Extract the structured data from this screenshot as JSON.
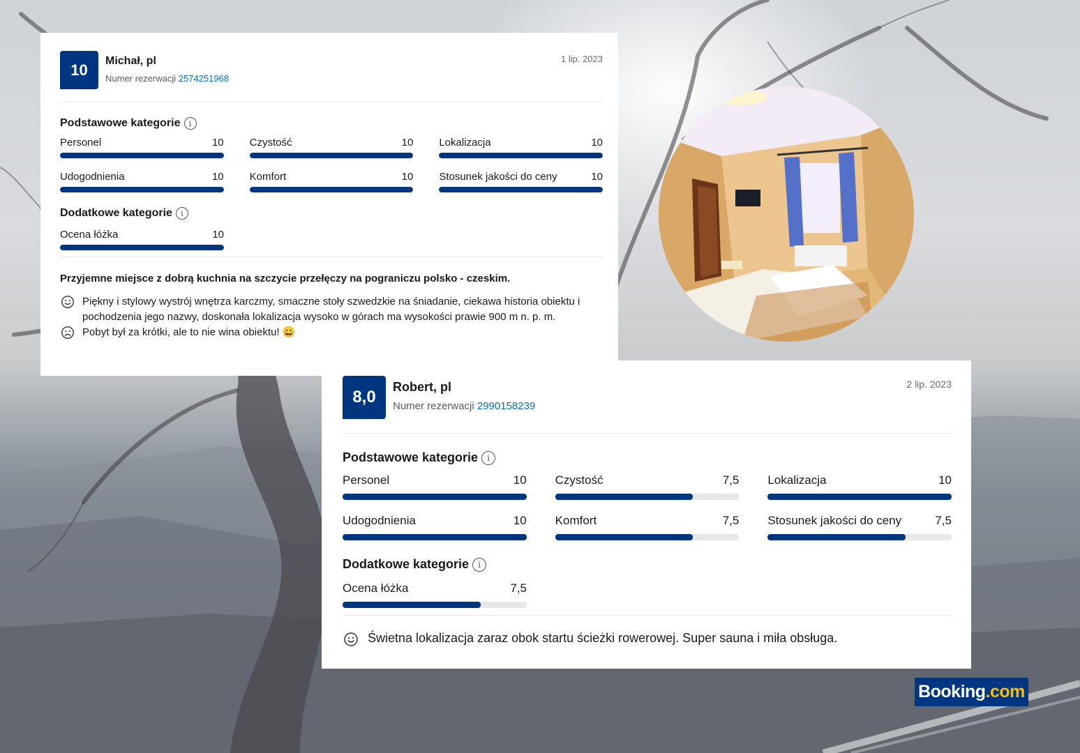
{
  "reviews": [
    {
      "score": "10",
      "name": "Michał, pl",
      "booking_label": "Numer rezerwacji",
      "booking_number": "2574251968",
      "date": "1 lip. 2023",
      "basic_title": "Podstawowe kategorie",
      "basic": [
        {
          "label": "Personel",
          "value": "10",
          "fraction": 1.0
        },
        {
          "label": "Czystość",
          "value": "10",
          "fraction": 1.0
        },
        {
          "label": "Lokalizacja",
          "value": "10",
          "fraction": 1.0
        },
        {
          "label": "Udogodnienia",
          "value": "10",
          "fraction": 1.0
        },
        {
          "label": "Komfort",
          "value": "10",
          "fraction": 1.0
        },
        {
          "label": "Stosunek jakości do ceny",
          "value": "10",
          "fraction": 1.0
        }
      ],
      "extra_title": "Dodatkowe kategorie",
      "extra": [
        {
          "label": "Ocena łóżka",
          "value": "10",
          "fraction": 1.0
        }
      ],
      "headline": "Przyjemne miejsce z dobrą kuchnia na szczycie przełęczy na pograniczu polsko - czeskim.",
      "positive": "Piękny i stylowy wystrój wnętrza karczmy, smaczne stoły szwedzkie na śniadanie, ciekawa historia obiektu i pochodzenia jego nazwy, doskonała lokalizacja wysoko w górach ma wysokości prawie 900 m n. p. m.",
      "negative": "Pobyt był za krótki, ale to nie wina obiektu! 😀"
    },
    {
      "score": "8,0",
      "name": "Robert, pl",
      "booking_label": "Numer rezerwacji",
      "booking_number": "2990158239",
      "date": "2 lip. 2023",
      "basic_title": "Podstawowe kategorie",
      "basic": [
        {
          "label": "Personel",
          "value": "10",
          "fraction": 1.0
        },
        {
          "label": "Czystość",
          "value": "7,5",
          "fraction": 0.75
        },
        {
          "label": "Lokalizacja",
          "value": "10",
          "fraction": 1.0
        },
        {
          "label": "Udogodnienia",
          "value": "10",
          "fraction": 1.0
        },
        {
          "label": "Komfort",
          "value": "7,5",
          "fraction": 0.75
        },
        {
          "label": "Stosunek jakości do ceny",
          "value": "7,5",
          "fraction": 0.75
        }
      ],
      "extra_title": "Dodatkowe kategorie",
      "extra": [
        {
          "label": "Ocena łóżka",
          "value": "7,5",
          "fraction": 0.75
        }
      ],
      "positive": "Świetna lokalizacja zaraz obok startu ścieżki rowerowej. Super sauna i miła obsługa."
    }
  ],
  "info_glyph": "i",
  "logo": {
    "text": "Booking",
    "suffix": ".com"
  },
  "colors": {
    "brand": "#003580",
    "link": "#0071c2",
    "track": "#e7e7e7",
    "logo_dot": "#febb02"
  },
  "icons": {
    "smile": "smile-icon",
    "sad": "sad-icon",
    "info": "info-icon"
  }
}
